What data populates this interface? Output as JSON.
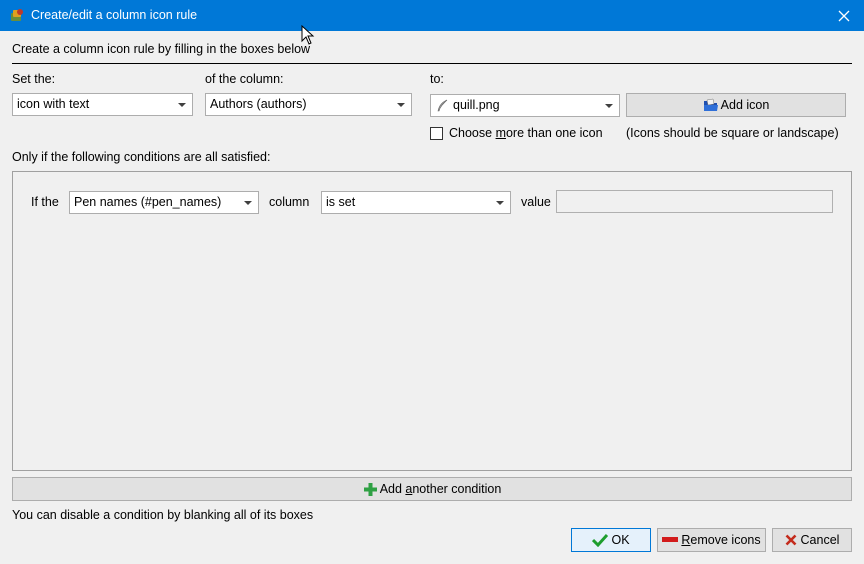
{
  "window": {
    "title": "Create/edit a column icon rule"
  },
  "intro": "Create a column icon rule by filling in the boxes below",
  "set_the": {
    "label": "Set the:",
    "value": "icon with text"
  },
  "of_column": {
    "label": "of the column:",
    "value": "Authors (authors)"
  },
  "to": {
    "label": "to:",
    "value": "quill.png"
  },
  "add_icon": {
    "label": "Add icon"
  },
  "choose_more": {
    "label_before": "Choose ",
    "label_u": "m",
    "label_after": "ore than one icon",
    "checked": false
  },
  "icons_hint": "(Icons should be square or landscape)",
  "conditions": {
    "heading": "Only if the following conditions are all satisfied:",
    "rows": [
      {
        "if_label": "If the",
        "column_value": "Pen names (#pen_names)",
        "column_label": "column",
        "op_value": "is set",
        "value_label": "value",
        "value": ""
      }
    ]
  },
  "add_condition": {
    "label_before": "Add ",
    "label_u": "a",
    "label_after": "nother condition"
  },
  "footer_hint": "You can disable a condition by blanking all of its boxes",
  "buttons": {
    "ok": "OK",
    "remove_u": "R",
    "remove_rest": "emove icons",
    "cancel": "Cancel"
  },
  "colors": {
    "titlebar": "#0078d7",
    "ok_check": "#1e9e2e",
    "plus": "#2ea043",
    "remove_bar": "#d21a1a",
    "cancel_x": "#c42b1c"
  }
}
